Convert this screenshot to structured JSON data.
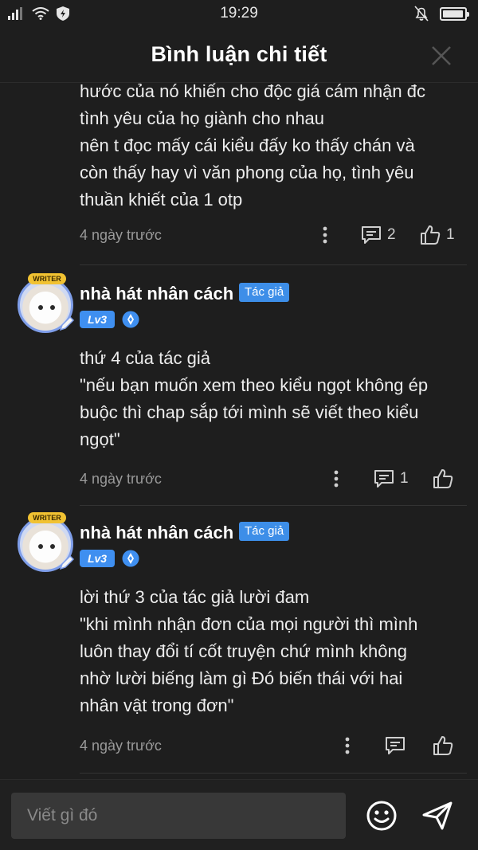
{
  "status_bar": {
    "time": "19:29",
    "battery_level": 0.95
  },
  "header": {
    "title": "Bình luận chi tiết"
  },
  "comments": [
    {
      "lines": [
        "hước của nó khiến cho độc giá cám nhận đc",
        "tình yêu của họ giành cho nhau",
        "nên t đọc mấy cái kiểu đấy ko thấy chán và",
        "còn thấy hay vì văn phong của họ, tình yêu",
        "thuần khiết của 1 otp"
      ],
      "time": "4 ngày trước",
      "reply_count": "2",
      "like_count": "1"
    },
    {
      "username": "nhà hát nhân cách",
      "author_badge": "Tác giả",
      "level": "Lv3",
      "avatar_badge": "WRITER",
      "lines": [
        "thứ 4 của tác giả",
        "\"nếu bạn muốn xem theo kiểu ngọt không ép",
        "buộc thì chap sắp tới mình sẽ viết theo kiểu",
        "ngọt\""
      ],
      "time": "4 ngày trước",
      "reply_count": "1",
      "like_count": ""
    },
    {
      "username": "nhà hát nhân cách",
      "author_badge": "Tác giả",
      "level": "Lv3",
      "avatar_badge": "WRITER",
      "lines": [
        "lời thứ 3 của tác giả lười đam",
        "\"khi mình nhận đơn của mọi người thì mình",
        "luôn thay đổi tí cốt truyện chứ mình không",
        "nhờ lười biếng làm gì Đó biến thái với hai",
        "nhân vật trong đơn\""
      ],
      "time": "4 ngày trước",
      "reply_count": "",
      "like_count": ""
    }
  ],
  "input": {
    "placeholder": "Viết gì đó"
  },
  "icons": {
    "more": "more-vertical-icon",
    "reply": "comment-icon",
    "like": "thumbs-up-icon",
    "emoji": "smiley-icon",
    "send": "send-icon",
    "close": "close-icon"
  },
  "colors": {
    "accent": "#3d8ee8",
    "background": "#1e1e1e",
    "input_bg": "#383838"
  }
}
